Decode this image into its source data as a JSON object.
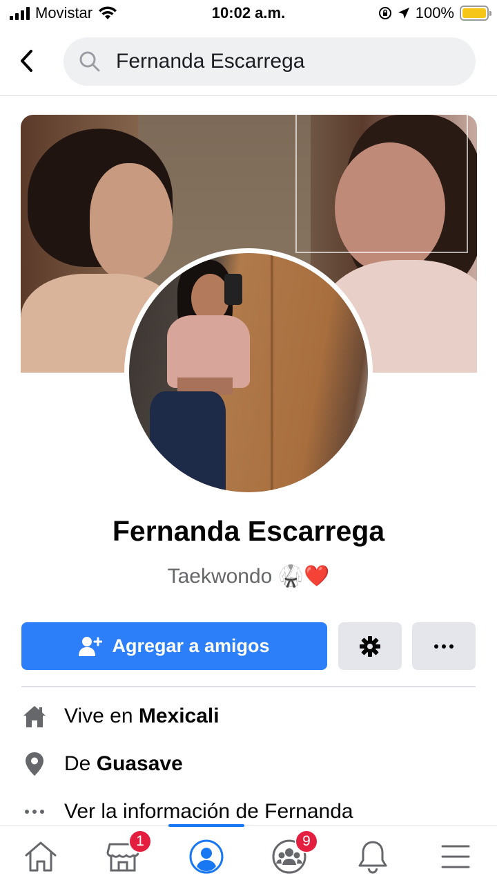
{
  "status_bar": {
    "carrier": "Movistar",
    "time": "10:02 a.m.",
    "battery": "100%"
  },
  "header": {
    "search_value": "Fernanda Escarrega"
  },
  "profile": {
    "name": "Fernanda Escarrega",
    "bio": "Taekwondo 🥋❤️"
  },
  "actions": {
    "add_friend_label": "Agregar a amigos"
  },
  "info": {
    "lives_prefix": "Vive en ",
    "lives_city": "Mexicali",
    "from_prefix": "De ",
    "from_city": "Guasave",
    "see_more": "Ver la información de Fernanda"
  },
  "bottom_nav": {
    "marketplace_badge": "1",
    "groups_badge": "9"
  },
  "colors": {
    "primary_button": "#2d7ff9",
    "active_tab": "#1877f2",
    "badge": "#e41e3f"
  }
}
